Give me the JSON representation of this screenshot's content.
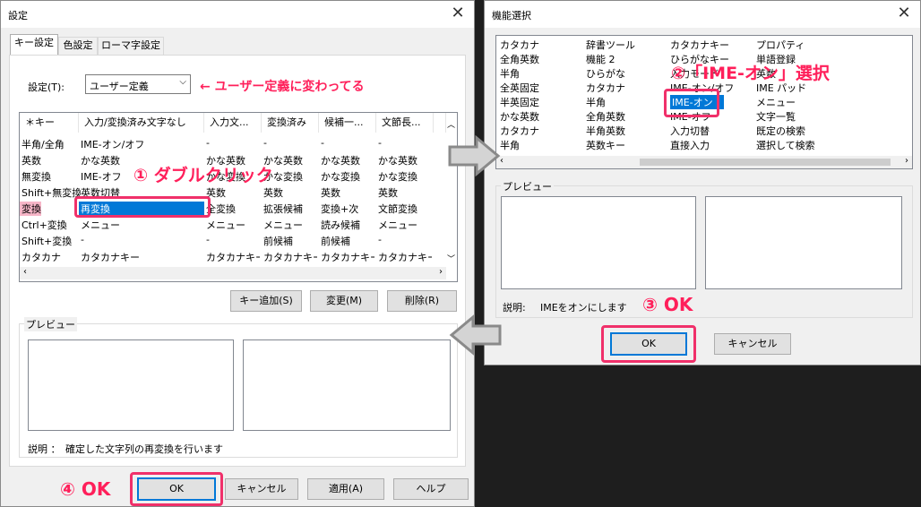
{
  "left_dialog": {
    "title": "設定",
    "tabs": [
      "キー設定",
      "色設定",
      "ローマ字設定"
    ],
    "setting_label": "設定(T):",
    "setting_value": "ユーザー定義",
    "columns": [
      "＊キー",
      "入力/変換済み文字なし",
      "入力文...",
      "変換済み",
      "候補一...",
      "文節長..."
    ],
    "rows": [
      [
        "半角/全角",
        "IME-オン/オフ",
        "-",
        "-",
        "-",
        "-"
      ],
      [
        "英数",
        "かな英数",
        "かな英数",
        "かな英数",
        "かな英数",
        "かな英数"
      ],
      [
        "無変換",
        "IME-オフ",
        "かな変換",
        "かな変換",
        "かな変換",
        "かな変換"
      ],
      [
        "Shift+無変換",
        "英数切替",
        "英数",
        "英数",
        "英数",
        "英数"
      ],
      [
        "変換",
        "再変換",
        "全変換",
        "拡張候補",
        "変換+次",
        "文節変換"
      ],
      [
        "Ctrl+変換",
        "メニュー",
        "メニュー",
        "メニュー",
        "読み候補",
        "メニュー"
      ],
      [
        "Shift+変換",
        "-",
        "-",
        "前候補",
        "前候補",
        "-"
      ],
      [
        "カタカナ",
        "カタカナキー",
        "カタカナキー",
        "カタカナキー",
        "カタカナキー",
        "カタカナキー"
      ]
    ],
    "buttons": {
      "add_key": "キー追加(S)",
      "change": "変更(M)",
      "delete": "削除(R)"
    },
    "preview_label": "プレビュー",
    "description": "説明 ：　確定した文字列の再変換を行います",
    "footer": {
      "ok": "OK",
      "cancel": "キャンセル",
      "apply": "適用(A)",
      "help": "ヘルプ"
    }
  },
  "right_dialog": {
    "title": "機能選択",
    "functions": [
      [
        "カタカナ",
        "辞書ツール",
        "カタカナキー",
        "プロパティ"
      ],
      [
        "全角英数",
        "機能 2",
        "ひらがなキー",
        "単語登録"
      ],
      [
        "半角",
        "ひらがな",
        "入力モード",
        "英数"
      ],
      [
        "全英固定",
        "カタカナ",
        "IME-オン/オフ",
        "IME パッド"
      ],
      [
        "半英固定",
        "半角",
        "IME-オン",
        "メニュー"
      ],
      [
        "かな英数",
        "全角英数",
        "IME-オフ",
        "文字一覧"
      ],
      [
        "カタカナ",
        "半角英数",
        "入力切替",
        "既定の検索"
      ],
      [
        "半角",
        "英数キー",
        "直接入力",
        "選択して検索"
      ]
    ],
    "preview_label": "プレビュー",
    "description_label": "説明:",
    "description": "IMEをオンにします",
    "ok": "OK",
    "cancel": "キャンセル"
  },
  "annotations": {
    "changed": "← ユーザー定義に変わってる",
    "step1": "① ダブルクリック",
    "step2": "②「IME-オン」選択",
    "step3": "③ OK",
    "step4": "④ OK"
  },
  "colors": {
    "highlight": "#f0306a",
    "selection": "#0078d7",
    "annotation": "#ff1f5a"
  }
}
